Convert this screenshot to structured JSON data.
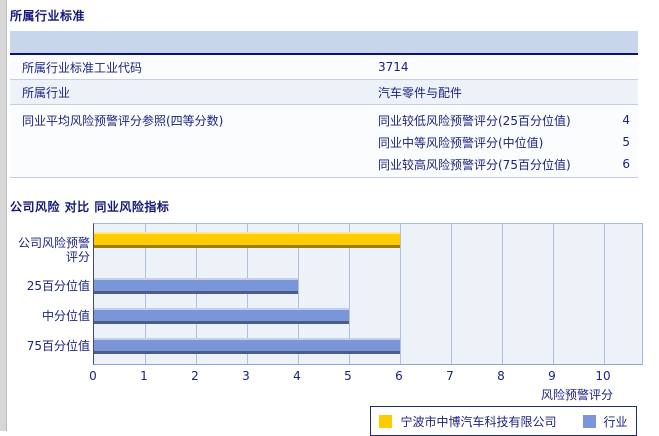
{
  "section1": {
    "title": "所属行业标准",
    "table": {
      "rows": [
        {
          "label": "所属行业标准工业代码",
          "value": "3714"
        },
        {
          "label": "所属行业",
          "value": "汽车零件与配件"
        },
        {
          "label": "同业平均风险预警评分参照(四等分数)",
          "subrows": [
            {
              "label": "同业较低风险预警评分(25百分位值)",
              "value": "4"
            },
            {
              "label": "同业中等风险预警评分(中位值)",
              "value": "5"
            },
            {
              "label": "同业较高风险预警评分(75百分位值)",
              "value": "6"
            }
          ]
        }
      ]
    }
  },
  "section2": {
    "title": "公司风险 对比 同业风险指标"
  },
  "chart_data": {
    "type": "bar",
    "orientation": "horizontal",
    "title": "公司风险 对比 同业风险指标",
    "categories": [
      "公司风险预警评分",
      "25百分位值",
      "中分位值",
      "75百分位值"
    ],
    "values": [
      6,
      4,
      5,
      6
    ],
    "bar_colors": [
      "#ffcc00",
      "#7b96d8",
      "#7b96d8",
      "#7b96d8"
    ],
    "xlabel": "风险预警评分",
    "xlim": [
      0,
      10
    ],
    "xticks": [
      0,
      1,
      2,
      3,
      4,
      5,
      6,
      7,
      8,
      9,
      10
    ],
    "grid": "vertical",
    "legend_position": "bottom-right",
    "legend": [
      {
        "label": "宁波市中博汽车科技有限公司",
        "color": "#ffcc00"
      },
      {
        "label": "行业",
        "color": "#7b96d8"
      }
    ],
    "colors": {
      "plot_background": "#edf1f8",
      "gridline": "#afc0e2",
      "company_bar": "#ffcc00",
      "industry_bar": "#7b96d8",
      "text": "#1b2380"
    }
  }
}
